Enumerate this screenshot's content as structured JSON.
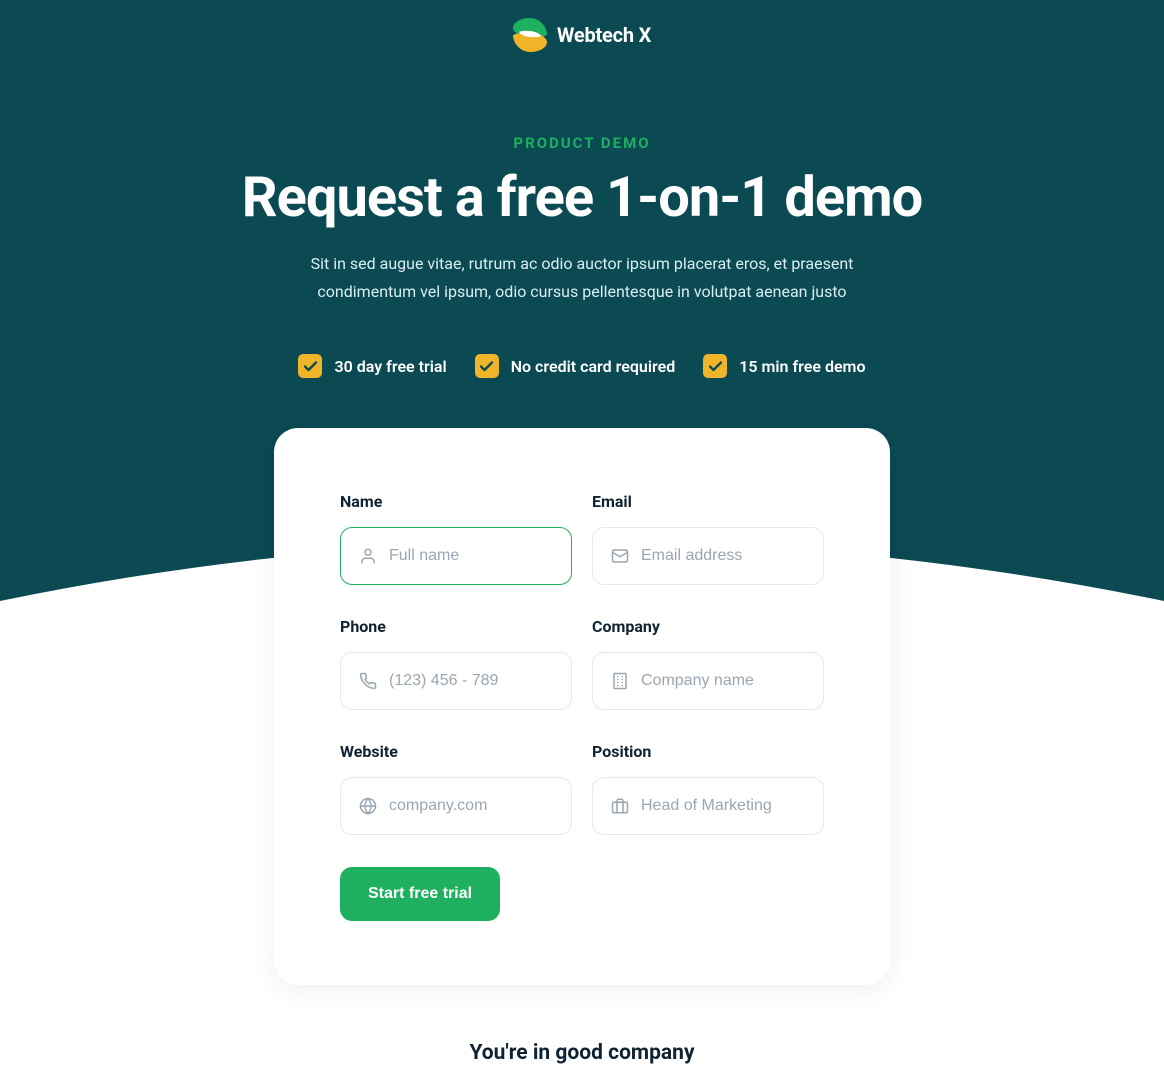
{
  "brand": {
    "name": "Webtech X"
  },
  "header": {
    "eyebrow": "PRODUCT DEMO",
    "title": "Request a free 1-on-1 demo",
    "subtitle": "Sit in sed augue vitae, rutrum ac odio auctor ipsum placerat eros, et praesent condimentum vel ipsum, odio cursus pellentesque in volutpat aenean justo"
  },
  "features": [
    "30 day free trial",
    "No credit card required",
    "15 min free demo"
  ],
  "form": {
    "name": {
      "label": "Name",
      "placeholder": "Full name"
    },
    "email": {
      "label": "Email",
      "placeholder": "Email address"
    },
    "phone": {
      "label": "Phone",
      "placeholder": "(123) 456 - 789"
    },
    "company": {
      "label": "Company",
      "placeholder": "Company name"
    },
    "website": {
      "label": "Website",
      "placeholder": "company.com"
    },
    "position": {
      "label": "Position",
      "placeholder": "Head of Marketing"
    },
    "submit_label": "Start free trial"
  },
  "footer": {
    "company_text": "You're in good company"
  },
  "colors": {
    "hero_bg": "#0b4953",
    "accent_green": "#1eb05e",
    "accent_yellow": "#f0b429"
  }
}
